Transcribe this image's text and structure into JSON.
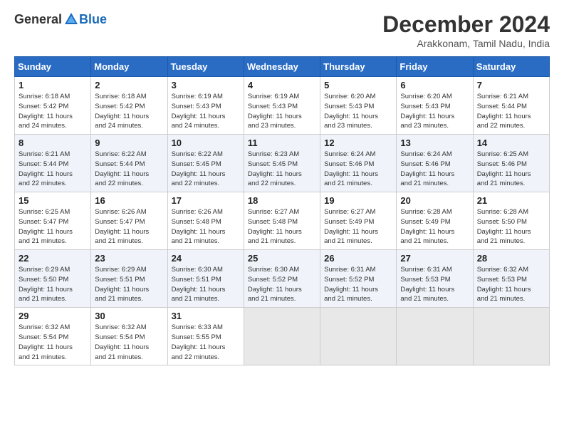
{
  "header": {
    "logo_general": "General",
    "logo_blue": "Blue",
    "month_title": "December 2024",
    "subtitle": "Arakkonam, Tamil Nadu, India"
  },
  "days_of_week": [
    "Sunday",
    "Monday",
    "Tuesday",
    "Wednesday",
    "Thursday",
    "Friday",
    "Saturday"
  ],
  "weeks": [
    [
      {
        "day": "1",
        "info": "Sunrise: 6:18 AM\nSunset: 5:42 PM\nDaylight: 11 hours\nand 24 minutes."
      },
      {
        "day": "2",
        "info": "Sunrise: 6:18 AM\nSunset: 5:42 PM\nDaylight: 11 hours\nand 24 minutes."
      },
      {
        "day": "3",
        "info": "Sunrise: 6:19 AM\nSunset: 5:43 PM\nDaylight: 11 hours\nand 24 minutes."
      },
      {
        "day": "4",
        "info": "Sunrise: 6:19 AM\nSunset: 5:43 PM\nDaylight: 11 hours\nand 23 minutes."
      },
      {
        "day": "5",
        "info": "Sunrise: 6:20 AM\nSunset: 5:43 PM\nDaylight: 11 hours\nand 23 minutes."
      },
      {
        "day": "6",
        "info": "Sunrise: 6:20 AM\nSunset: 5:43 PM\nDaylight: 11 hours\nand 23 minutes."
      },
      {
        "day": "7",
        "info": "Sunrise: 6:21 AM\nSunset: 5:44 PM\nDaylight: 11 hours\nand 22 minutes."
      }
    ],
    [
      {
        "day": "8",
        "info": "Sunrise: 6:21 AM\nSunset: 5:44 PM\nDaylight: 11 hours\nand 22 minutes."
      },
      {
        "day": "9",
        "info": "Sunrise: 6:22 AM\nSunset: 5:44 PM\nDaylight: 11 hours\nand 22 minutes."
      },
      {
        "day": "10",
        "info": "Sunrise: 6:22 AM\nSunset: 5:45 PM\nDaylight: 11 hours\nand 22 minutes."
      },
      {
        "day": "11",
        "info": "Sunrise: 6:23 AM\nSunset: 5:45 PM\nDaylight: 11 hours\nand 22 minutes."
      },
      {
        "day": "12",
        "info": "Sunrise: 6:24 AM\nSunset: 5:46 PM\nDaylight: 11 hours\nand 21 minutes."
      },
      {
        "day": "13",
        "info": "Sunrise: 6:24 AM\nSunset: 5:46 PM\nDaylight: 11 hours\nand 21 minutes."
      },
      {
        "day": "14",
        "info": "Sunrise: 6:25 AM\nSunset: 5:46 PM\nDaylight: 11 hours\nand 21 minutes."
      }
    ],
    [
      {
        "day": "15",
        "info": "Sunrise: 6:25 AM\nSunset: 5:47 PM\nDaylight: 11 hours\nand 21 minutes."
      },
      {
        "day": "16",
        "info": "Sunrise: 6:26 AM\nSunset: 5:47 PM\nDaylight: 11 hours\nand 21 minutes."
      },
      {
        "day": "17",
        "info": "Sunrise: 6:26 AM\nSunset: 5:48 PM\nDaylight: 11 hours\nand 21 minutes."
      },
      {
        "day": "18",
        "info": "Sunrise: 6:27 AM\nSunset: 5:48 PM\nDaylight: 11 hours\nand 21 minutes."
      },
      {
        "day": "19",
        "info": "Sunrise: 6:27 AM\nSunset: 5:49 PM\nDaylight: 11 hours\nand 21 minutes."
      },
      {
        "day": "20",
        "info": "Sunrise: 6:28 AM\nSunset: 5:49 PM\nDaylight: 11 hours\nand 21 minutes."
      },
      {
        "day": "21",
        "info": "Sunrise: 6:28 AM\nSunset: 5:50 PM\nDaylight: 11 hours\nand 21 minutes."
      }
    ],
    [
      {
        "day": "22",
        "info": "Sunrise: 6:29 AM\nSunset: 5:50 PM\nDaylight: 11 hours\nand 21 minutes."
      },
      {
        "day": "23",
        "info": "Sunrise: 6:29 AM\nSunset: 5:51 PM\nDaylight: 11 hours\nand 21 minutes."
      },
      {
        "day": "24",
        "info": "Sunrise: 6:30 AM\nSunset: 5:51 PM\nDaylight: 11 hours\nand 21 minutes."
      },
      {
        "day": "25",
        "info": "Sunrise: 6:30 AM\nSunset: 5:52 PM\nDaylight: 11 hours\nand 21 minutes."
      },
      {
        "day": "26",
        "info": "Sunrise: 6:31 AM\nSunset: 5:52 PM\nDaylight: 11 hours\nand 21 minutes."
      },
      {
        "day": "27",
        "info": "Sunrise: 6:31 AM\nSunset: 5:53 PM\nDaylight: 11 hours\nand 21 minutes."
      },
      {
        "day": "28",
        "info": "Sunrise: 6:32 AM\nSunset: 5:53 PM\nDaylight: 11 hours\nand 21 minutes."
      }
    ],
    [
      {
        "day": "29",
        "info": "Sunrise: 6:32 AM\nSunset: 5:54 PM\nDaylight: 11 hours\nand 21 minutes."
      },
      {
        "day": "30",
        "info": "Sunrise: 6:32 AM\nSunset: 5:54 PM\nDaylight: 11 hours\nand 21 minutes."
      },
      {
        "day": "31",
        "info": "Sunrise: 6:33 AM\nSunset: 5:55 PM\nDaylight: 11 hours\nand 22 minutes."
      },
      {
        "day": "",
        "info": ""
      },
      {
        "day": "",
        "info": ""
      },
      {
        "day": "",
        "info": ""
      },
      {
        "day": "",
        "info": ""
      }
    ]
  ]
}
